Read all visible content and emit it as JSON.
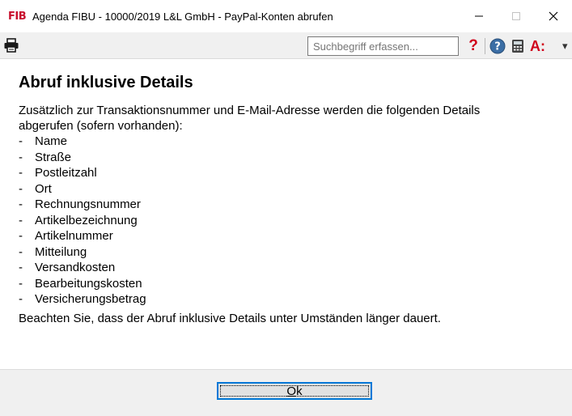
{
  "window": {
    "app_logo": "FIB",
    "title": "Agenda FIBU - 10000/2019 L&L GmbH - PayPal-Konten abrufen"
  },
  "toolbar": {
    "search": {
      "placeholder": "Suchbegriff erfassen...",
      "value": ""
    },
    "question_glyph": "?",
    "abc_glyph": "A:",
    "icons": [
      "printer-icon",
      "question-icon",
      "help-circle-icon",
      "calculator-icon",
      "abc-icon"
    ]
  },
  "content": {
    "heading": "Abruf inklusive Details",
    "intro": "Zusätzlich zur Transaktionsnummer und E-Mail-Adresse werden die folgenden Details abgerufen (sofern vorhanden):",
    "bullet": "-",
    "items": [
      "Name",
      "Straße",
      "Postleitzahl",
      "Ort",
      "Rechnungsnummer",
      "Artikelbezeichnung",
      "Artikelnummer",
      "Mitteilung",
      "Versandkosten",
      "Bearbeitungskosten",
      "Versicherungsbetrag"
    ],
    "note": "Beachten Sie, dass der Abruf inklusive Details unter Umständen länger dauert."
  },
  "buttons": {
    "ok_mnemonic": "O",
    "ok_rest": "k"
  },
  "colors": {
    "brand_red": "#d0021b",
    "focus_blue": "#0078d7",
    "toolbar_bg": "#f0f0f0"
  }
}
